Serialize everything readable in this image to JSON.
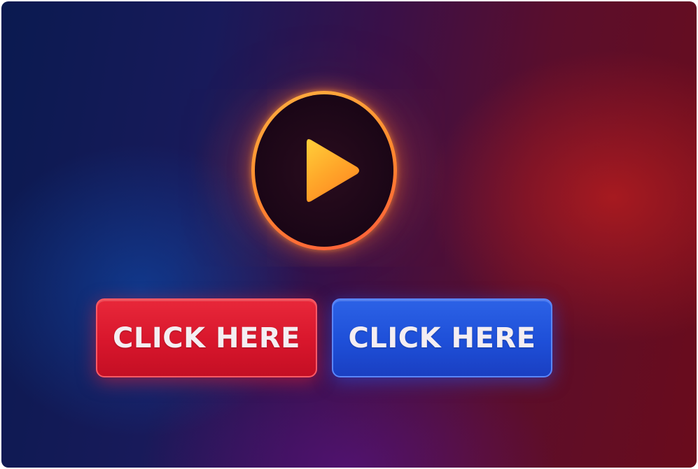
{
  "play_button": {
    "icon": "play-icon",
    "ring_color": "#ff8a2e",
    "icon_color": "#ffb02e"
  },
  "buttons": [
    {
      "label": "CLICK HERE",
      "color": "#d8162c"
    },
    {
      "label": "CLICK HERE",
      "color": "#1e4fd8"
    }
  ]
}
